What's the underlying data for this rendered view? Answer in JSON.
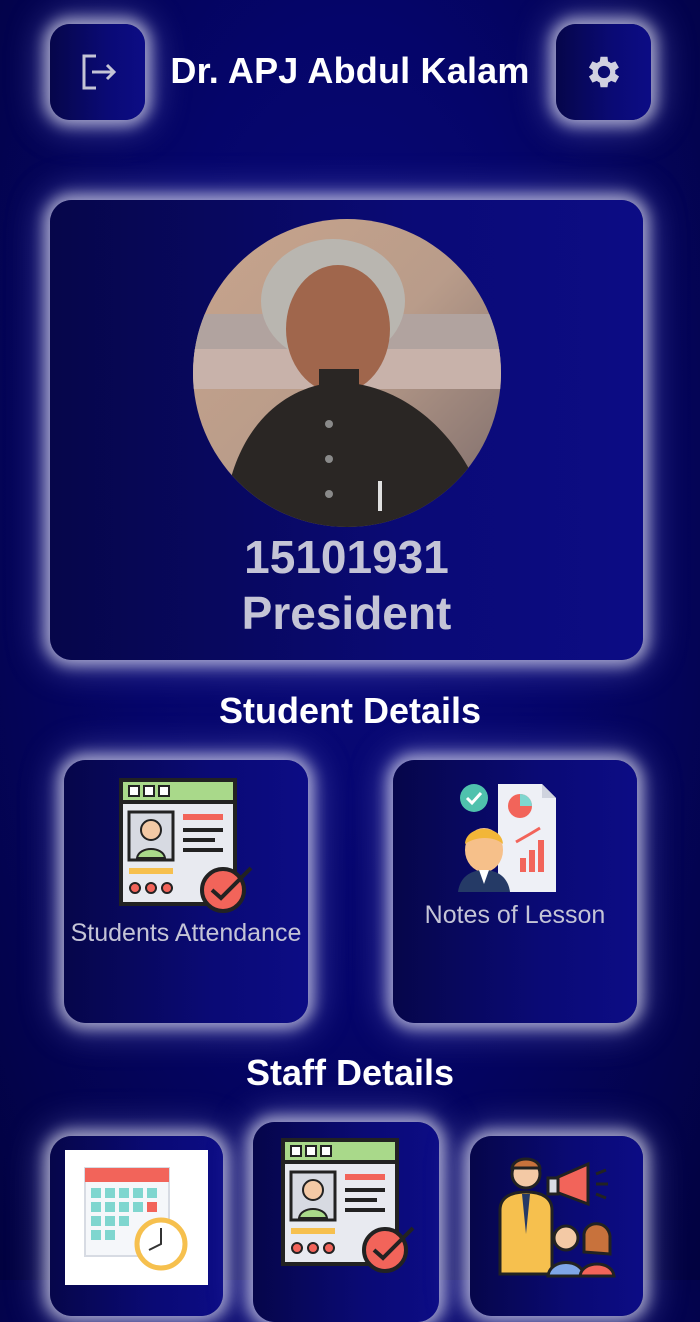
{
  "header": {
    "title": "Dr. APJ Abdul Kalam",
    "logout_icon": "logout-icon",
    "settings_icon": "gear-icon"
  },
  "profile": {
    "id": "15101931",
    "role": "President",
    "avatar": "profile-photo"
  },
  "sections": {
    "student_title": "Student Details",
    "staff_title": "Staff Details"
  },
  "student_tiles": [
    {
      "label": "Students Attendance",
      "icon": "attendance-card-icon"
    },
    {
      "label": "Notes of Lesson",
      "icon": "lesson-notes-icon"
    }
  ],
  "staff_tiles": [
    {
      "icon": "calendar-clock-icon"
    },
    {
      "icon": "attendance-card-icon"
    },
    {
      "icon": "staff-announcement-icon"
    }
  ],
  "colors": {
    "background": "#05056a",
    "card_text": "#c4c4d6",
    "accent_green": "#a9d98a",
    "accent_red": "#f2645a"
  }
}
